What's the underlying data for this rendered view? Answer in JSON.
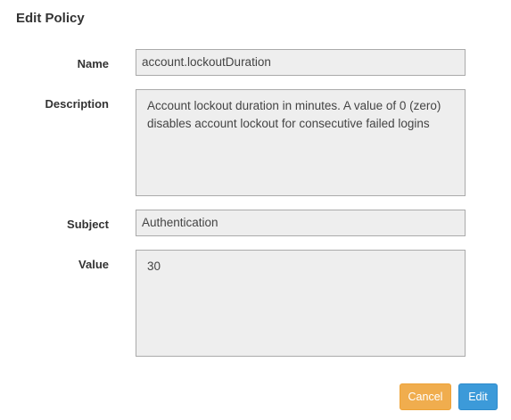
{
  "dialog": {
    "title": "Edit Policy"
  },
  "form": {
    "name": {
      "label": "Name",
      "value": "account.lockoutDuration"
    },
    "description": {
      "label": "Description",
      "value": "Account lockout duration in minutes. A value of 0 (zero) disables account lockout for consecutive failed logins"
    },
    "subject": {
      "label": "Subject",
      "value": "Authentication"
    },
    "value": {
      "label": "Value",
      "value": "30"
    }
  },
  "buttons": {
    "cancel_label": "Cancel",
    "edit_label": "Edit",
    "cancel_color": "#f0ad4e",
    "edit_color": "#3c9ad9"
  }
}
